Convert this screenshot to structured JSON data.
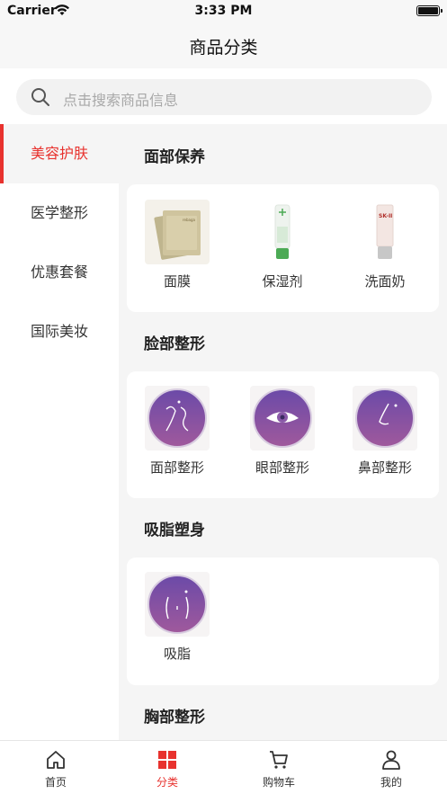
{
  "status_bar": {
    "carrier": "Carrier",
    "time": "3:33 PM"
  },
  "nav": {
    "title": "商品分类"
  },
  "search": {
    "placeholder": "点击搜索商品信息"
  },
  "sidebar": {
    "items": [
      {
        "label": "美容护肤",
        "active": true
      },
      {
        "label": "医学整形",
        "active": false
      },
      {
        "label": "优惠套餐",
        "active": false
      },
      {
        "label": "国际美妆",
        "active": false
      }
    ]
  },
  "sections": [
    {
      "title": "面部保养",
      "items": [
        {
          "label": "面膜",
          "icon": "face-mask-product-image"
        },
        {
          "label": "保湿剂",
          "icon": "moisturizer-tube-image"
        },
        {
          "label": "洗面奶",
          "icon": "cleanser-tube-image"
        }
      ]
    },
    {
      "title": "脸部整形",
      "items": [
        {
          "label": "面部整形",
          "icon": "face-contour-icon"
        },
        {
          "label": "眼部整形",
          "icon": "eye-icon"
        },
        {
          "label": "鼻部整形",
          "icon": "nose-icon"
        }
      ]
    },
    {
      "title": "吸脂塑身",
      "items": [
        {
          "label": "吸脂",
          "icon": "body-contour-icon"
        }
      ]
    },
    {
      "title": "胸部整形",
      "items": []
    }
  ],
  "tabbar": {
    "items": [
      {
        "label": "首页",
        "icon": "home-icon"
      },
      {
        "label": "分类",
        "icon": "category-grid-icon",
        "active": true
      },
      {
        "label": "购物车",
        "icon": "cart-icon"
      },
      {
        "label": "我的",
        "icon": "user-icon"
      }
    ]
  },
  "colors": {
    "accent": "#e8322e",
    "purple_top": "#6b4aa8",
    "purple_bottom": "#a0599c"
  }
}
